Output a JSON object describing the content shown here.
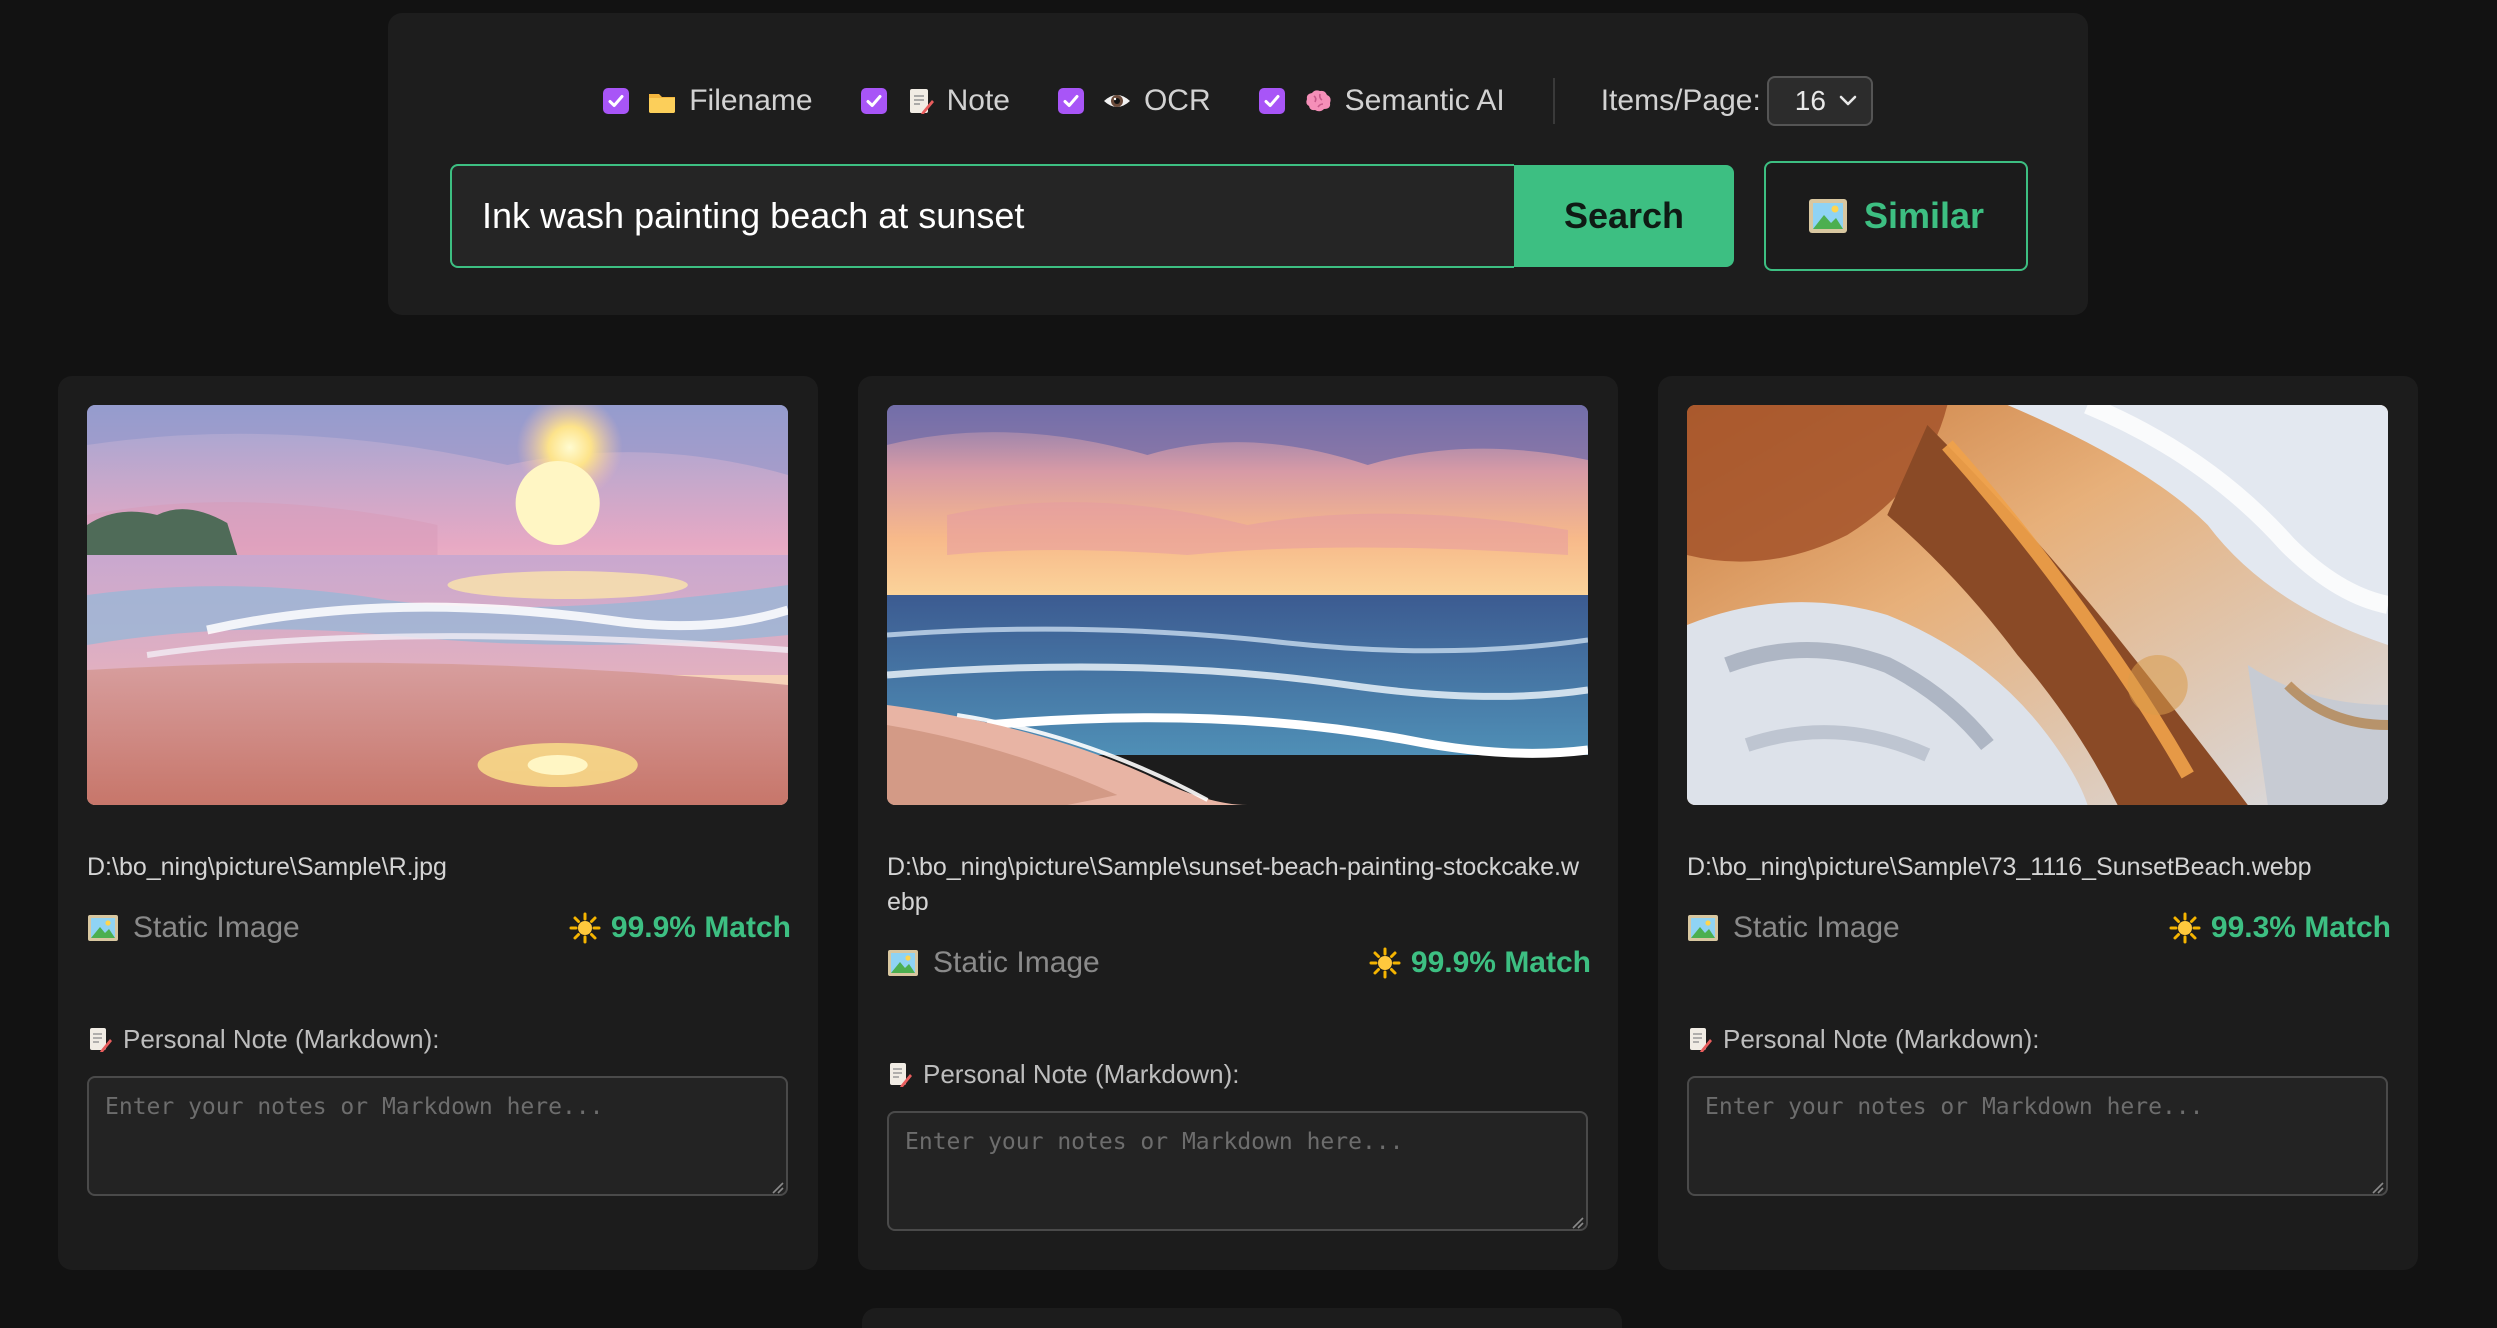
{
  "filters": [
    {
      "label": "Filename",
      "checked": true,
      "icon": "folder-icon"
    },
    {
      "label": "Note",
      "checked": true,
      "icon": "memo-icon"
    },
    {
      "label": "OCR",
      "checked": true,
      "icon": "eye-icon"
    },
    {
      "label": "Semantic AI",
      "checked": true,
      "icon": "brain-icon"
    }
  ],
  "items_per_page": {
    "label": "Items/Page:",
    "value": "16"
  },
  "search": {
    "query": "Ink wash painting beach at sunset",
    "button_label": "Search",
    "similar_label": "Similar"
  },
  "results": [
    {
      "path": "D:\\bo_ning\\picture\\Sample\\R.jpg",
      "type": "Static Image",
      "match": "99.9% Match",
      "note_label": "Personal Note (Markdown):",
      "note_placeholder": "Enter your notes or Markdown here..."
    },
    {
      "path": "D:\\bo_ning\\picture\\Sample\\sunset-beach-painting-stockcake.webp",
      "type": "Static Image",
      "match": "99.9% Match",
      "note_label": "Personal Note (Markdown):",
      "note_placeholder": "Enter your notes or Markdown here..."
    },
    {
      "path": "D:\\bo_ning\\picture\\Sample\\73_1116_SunsetBeach.webp",
      "type": "Static Image",
      "match": "99.3% Match",
      "note_label": "Personal Note (Markdown):",
      "note_placeholder": "Enter your notes or Markdown here..."
    }
  ],
  "colors": {
    "accent": "#3dbf82",
    "checkbox": "#a855f7",
    "background": "#121212",
    "panel": "#1d1d1d"
  }
}
